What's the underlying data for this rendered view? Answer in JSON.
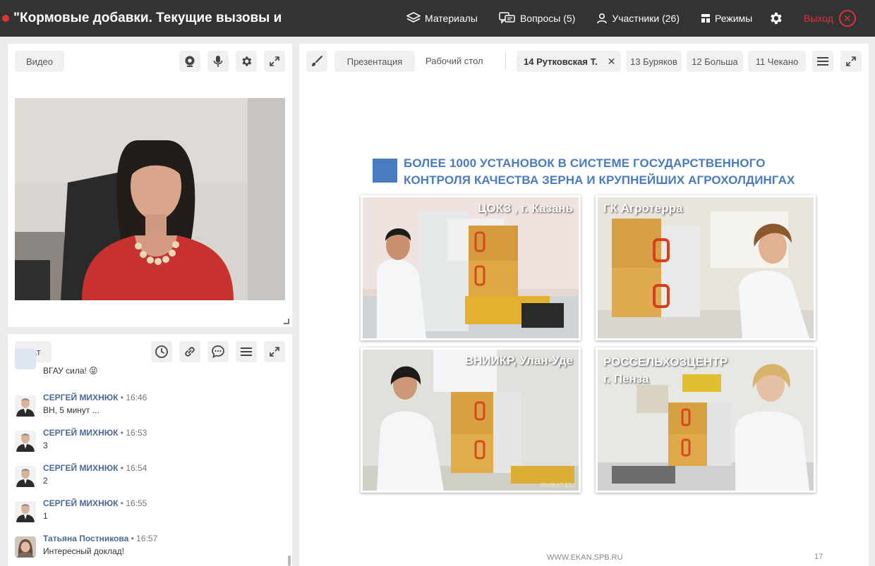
{
  "header": {
    "title": "\"Кормовые добавки. Текущие вызовы и",
    "nav": {
      "materials": "Материалы",
      "questions": "Вопросы (5)",
      "participants": "Участники (26)",
      "modes": "Режимы"
    },
    "exit_label": "Выход",
    "colors": {
      "bar": "#333333",
      "accent": "#e0303a"
    }
  },
  "video_panel": {
    "label": "Видео"
  },
  "chat_panel": {
    "label": "Чат",
    "messages": [
      {
        "author": "",
        "time": "",
        "text": "ВГАУ сила! 😜",
        "partial": true
      },
      {
        "author": "СЕРГЕЙ МИХНЮК",
        "time": "• 16:46",
        "text": "ВН, 5 минут ..."
      },
      {
        "author": "СЕРГЕЙ МИХНЮК",
        "time": "• 16:53",
        "text": "3"
      },
      {
        "author": "СЕРГЕЙ МИХНЮК",
        "time": "• 16:54",
        "text": "2"
      },
      {
        "author": "СЕРГЕЙ МИХНЮК",
        "time": "• 16:55",
        "text": "1"
      },
      {
        "author": "Татьяна Постникова",
        "time": "• 16:57",
        "text": "Интересный доклад!"
      }
    ]
  },
  "presentation_panel": {
    "tabs": {
      "presentation": "Презентация",
      "desktop": "Рабочий стол"
    },
    "doc_tabs": [
      {
        "label": "14 Рутковская Т.",
        "active": true
      },
      {
        "label": "13 Буряков"
      },
      {
        "label": "12 Больша"
      },
      {
        "label": "11 Чекано"
      }
    ],
    "slide": {
      "title_line1": "БОЛЕЕ 1000 УСТАНОВОК В СИСТЕМЕ ГОСУДАРСТВЕННОГО",
      "title_line2": "КОНТРОЛЯ КАЧЕСТВА ЗЕРНА И КРУПНЕЙШИХ АГРОХОЛДИНГАХ",
      "photos": [
        {
          "caption": "ЦОКЗ , г. Казань"
        },
        {
          "caption": "ГК Агротерра"
        },
        {
          "caption": "ВНИИКР, Улан-Уде"
        },
        {
          "caption_line1": "РОССЕЛЬХОЗЦЕНТР",
          "caption_line2": "г. Пенза"
        }
      ],
      "photo_stamp": "28-06-17 12:1",
      "footer": "WWW.EKAN.SPB.RU",
      "page_number": "17",
      "accent": "#4a7bbf"
    }
  }
}
